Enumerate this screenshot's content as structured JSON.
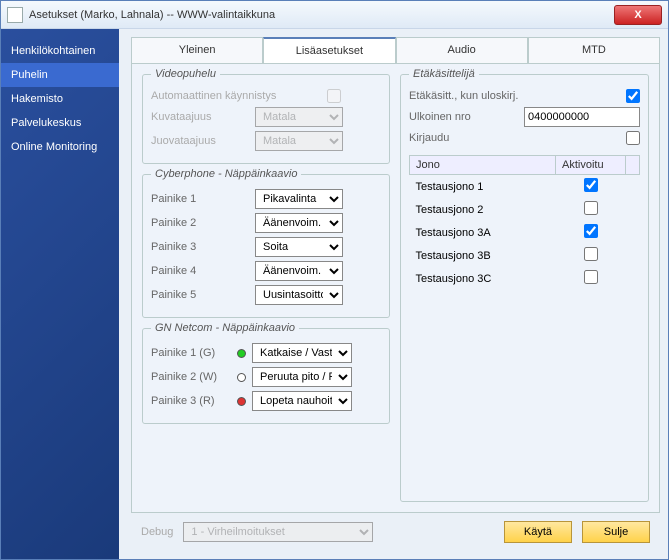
{
  "window": {
    "title": "Asetukset (Marko, Lahnala) -- WWW-valintaikkuna"
  },
  "close_glyph": "X",
  "sidebar": {
    "items": [
      {
        "label": "Henkilökohtainen"
      },
      {
        "label": "Puhelin"
      },
      {
        "label": "Hakemisto"
      },
      {
        "label": "Palvelukeskus"
      },
      {
        "label": "Online Monitoring"
      }
    ]
  },
  "tabs": {
    "items": [
      {
        "label": "Yleinen"
      },
      {
        "label": "Lisäasetukset"
      },
      {
        "label": "Audio"
      },
      {
        "label": "MTD"
      }
    ]
  },
  "video": {
    "legend": "Videopuhelu",
    "auto_label": "Automaattinen käynnistys",
    "frame_label": "Kuvataajuus",
    "frame_value": "Matala",
    "line_label": "Juovataajuus",
    "line_value": "Matala"
  },
  "cyber": {
    "legend": "Cyberphone - Näppäinkaavio",
    "rows": [
      {
        "label": "Painike 1",
        "value": "Pikavalinta"
      },
      {
        "label": "Painike 2",
        "value": "Äänenvoim. +"
      },
      {
        "label": "Painike 3",
        "value": "Soita"
      },
      {
        "label": "Painike 4",
        "value": "Äänenvoim. -"
      },
      {
        "label": "Painike 5",
        "value": "Uusintasoitto"
      }
    ]
  },
  "gn": {
    "legend": "GN Netcom - Näppäinkaavio",
    "rows": [
      {
        "label": "Painike 1 (G)",
        "value": "Katkaise / Vastaa"
      },
      {
        "label": "Painike 2 (W)",
        "value": "Peruuta pito / Pito"
      },
      {
        "label": "Painike 3 (R)",
        "value": "Lopeta nauhoitus"
      }
    ]
  },
  "remote": {
    "legend": "Etäkäsittelijä",
    "logout_label": "Etäkäsitt., kun uloskirj.",
    "ext_label": "Ulkoinen nro",
    "ext_value": "0400000000",
    "login_label": "Kirjaudu",
    "queue_header": "Jono",
    "activated_header": "Aktivoitu",
    "queues": [
      {
        "name": "Testausjono 1",
        "active": true
      },
      {
        "name": "Testausjono 2",
        "active": false
      },
      {
        "name": "Testausjono 3A",
        "active": true
      },
      {
        "name": "Testausjono 3B",
        "active": false
      },
      {
        "name": "Testausjono 3C",
        "active": false
      }
    ]
  },
  "footer": {
    "debug_label": "Debug",
    "debug_value": "1 - Virheilmoitukset",
    "apply": "Käytä",
    "close": "Sulje"
  }
}
